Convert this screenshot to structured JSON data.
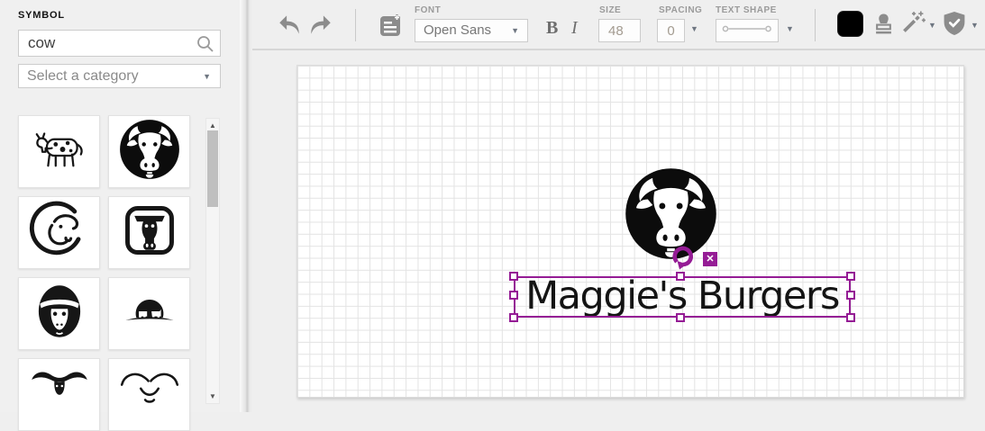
{
  "colors": {
    "selection": "#951c95",
    "color_swatch": "#000000",
    "icon_gray": "#8c8c8c"
  },
  "sidebar": {
    "title": "SYMBOL",
    "search_value": "cow",
    "category_value": "Select a category",
    "tiles": [
      {
        "name": "spotted-cow-icon"
      },
      {
        "name": "bull-head-circle-icon"
      },
      {
        "name": "bull-head-swoosh-icon"
      },
      {
        "name": "cow-head-frame-icon"
      },
      {
        "name": "cow-face-oval-icon"
      },
      {
        "name": "cattle-hill-icon"
      },
      {
        "name": "longhorn-icon"
      },
      {
        "name": "bull-horns-icon"
      }
    ]
  },
  "toolbar": {
    "font_label": "FONT",
    "font_value": "Open Sans",
    "bold_label": "B",
    "italic_label": "I",
    "size_label": "SIZE",
    "size_value": "48",
    "spacing_label": "SPACING",
    "spacing_value": "0",
    "text_shape_label": "TEXT SHAPE"
  },
  "canvas": {
    "logo_text": "Maggie's Burgers",
    "delete_glyph": "✕"
  }
}
